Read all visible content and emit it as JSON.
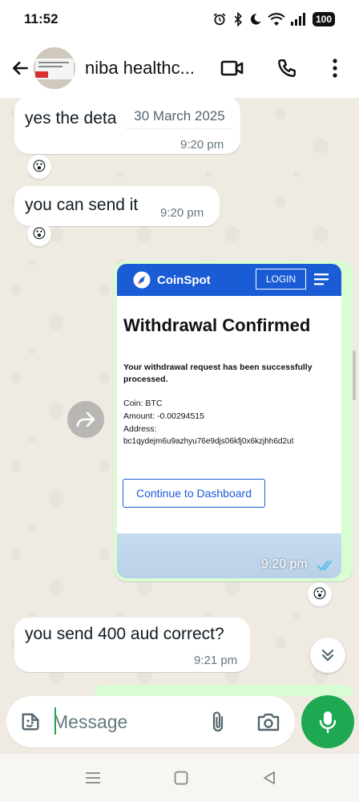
{
  "status_bar": {
    "time": "11:52",
    "battery": "100"
  },
  "header": {
    "contact_name": "niba healthc..."
  },
  "date_chip": "30 March 2025",
  "messages": [
    {
      "text": "yes the deta",
      "time": "9:20 pm",
      "reaction": "😮"
    },
    {
      "text": "you can send it",
      "time": "9:20 pm",
      "reaction": "😮"
    },
    {
      "time": "9:20 pm",
      "reaction": "😮"
    },
    {
      "text": "you send 400 aud correct?",
      "time": "9:21 pm"
    }
  ],
  "screenshot": {
    "brand": "CoinSpot",
    "login": "LOGIN",
    "title": "Withdrawal Confirmed",
    "message": "Your withdrawal request has been successfully processed.",
    "coin": "Coin: BTC",
    "amount": "Amount: -0.00294515",
    "address_label": "Address:",
    "address": "bc1qydejm6u9azhyu76e9djs06kfj0x6kzjhh6d2ut",
    "button": "Continue to Dashboard"
  },
  "composer": {
    "placeholder": "Message"
  },
  "colors": {
    "accent": "#1da851",
    "coinspot_blue": "#1a5bd6",
    "outgoing": "#d9fdd3",
    "read_ticks": "#53bdeb"
  }
}
